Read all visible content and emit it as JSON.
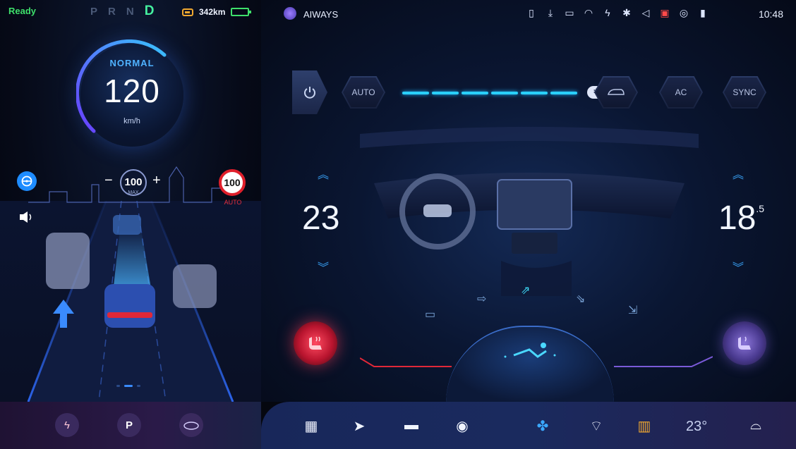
{
  "cluster": {
    "ready": "Ready",
    "gears": [
      "P",
      "R",
      "N",
      "D"
    ],
    "active_gear": "D",
    "range": "342km",
    "battery_level": 0.85,
    "drive_mode": "NORMAL",
    "speed": "120",
    "speed_unit": "km/h",
    "set_speed": "100",
    "set_speed_label": "MAX",
    "minus": "−",
    "plus": "+",
    "speed_limit": "100",
    "speed_limit_mode": "AUTO"
  },
  "status_bar": {
    "app_name": "AIWAYS",
    "time": "10:48",
    "icons": [
      "sim-icon",
      "download-icon",
      "message-icon",
      "wifi-icon",
      "hotspot-icon",
      "bluetooth-icon",
      "mute-icon",
      "camera-icon",
      "gps-icon",
      "signal-icon"
    ]
  },
  "climate": {
    "auto_label": "AUTO",
    "ac_label": "AC",
    "sync_label": "SYNC",
    "fan_level": "7",
    "fan_segments": 6,
    "temp_left": "23",
    "temp_right": "18",
    "temp_right_decimal": ".5"
  },
  "dock": {
    "outside_temp": "23°",
    "left_items": [
      "charge-icon",
      "park-assist-icon",
      "360-camera-icon"
    ],
    "right_items": [
      "apps-icon",
      "navigation-icon",
      "car-icon",
      "media-icon",
      "fan-icon",
      "front-defrost-icon",
      "rear-defrost-icon",
      "recirculation-icon"
    ]
  },
  "colors": {
    "accent": "#2ad0ff",
    "ready_green": "#3ee06b",
    "seat_heat_red": "#ff4a60",
    "rear_defrost_orange": "#f0a830"
  }
}
